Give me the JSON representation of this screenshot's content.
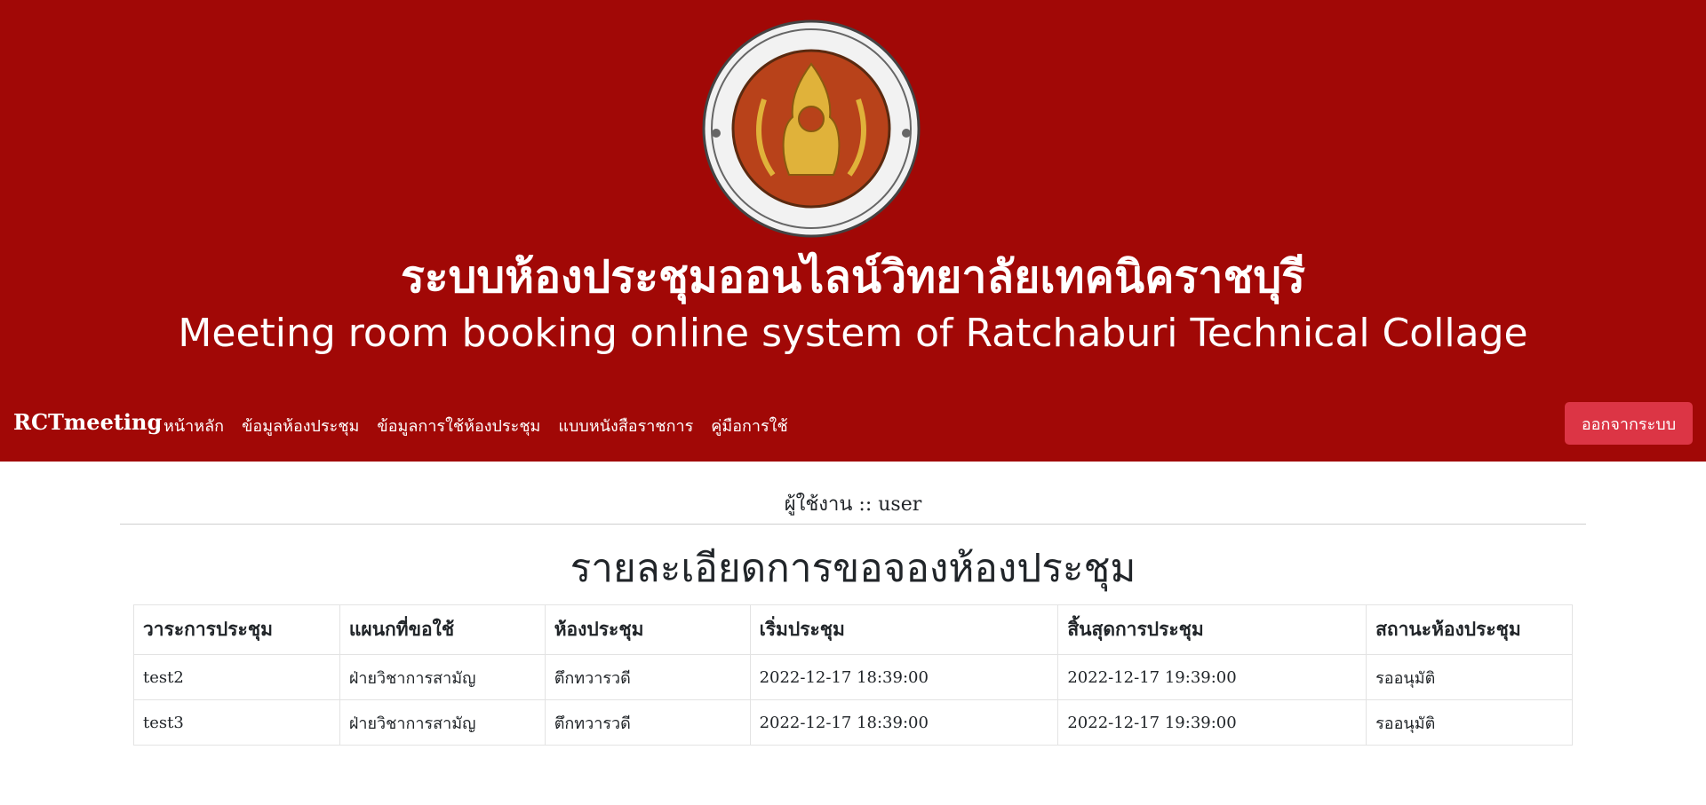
{
  "header": {
    "title_th": "ระบบห้องประชุมออนไลน์วิทยาลัยเทคนิคราชบุรี",
    "title_en": "Meeting room booking online system of Ratchaburi Technical Collage"
  },
  "navbar": {
    "brand": "RCTmeeting",
    "links": [
      "หน้าหลัก",
      "ข้อมูลห้องประชุม",
      "ข้อมูลการใช้ห้องประชุม",
      "แบบหนังสือราชการ",
      "คู่มือการใช้"
    ],
    "logout": "ออกจากระบบ"
  },
  "user": {
    "label": "ผู้ใช้งาน :: user"
  },
  "page": {
    "title": "รายละเอียดการขอจองห้องประชุม"
  },
  "table": {
    "headers": [
      "วาระการประชุม",
      "แผนกที่ขอใช้",
      "ห้องประชุม",
      "เริ่มประชุม",
      "สิ้นสุดการประชุม",
      "สถานะห้องประชุม"
    ],
    "rows": [
      [
        "test2",
        "ฝ่ายวิชาการสามัญ",
        "ตึกทวารวดี",
        "2022-12-17 18:39:00",
        "2022-12-17 19:39:00",
        "รออนุมัติ"
      ],
      [
        "test3",
        "ฝ่ายวิชาการสามัญ",
        "ตึกทวารวดี",
        "2022-12-17 18:39:00",
        "2022-12-17 19:39:00",
        "รออนุมัติ"
      ]
    ]
  },
  "colors": {
    "banner": "#a10806",
    "logout": "#dc3545"
  }
}
